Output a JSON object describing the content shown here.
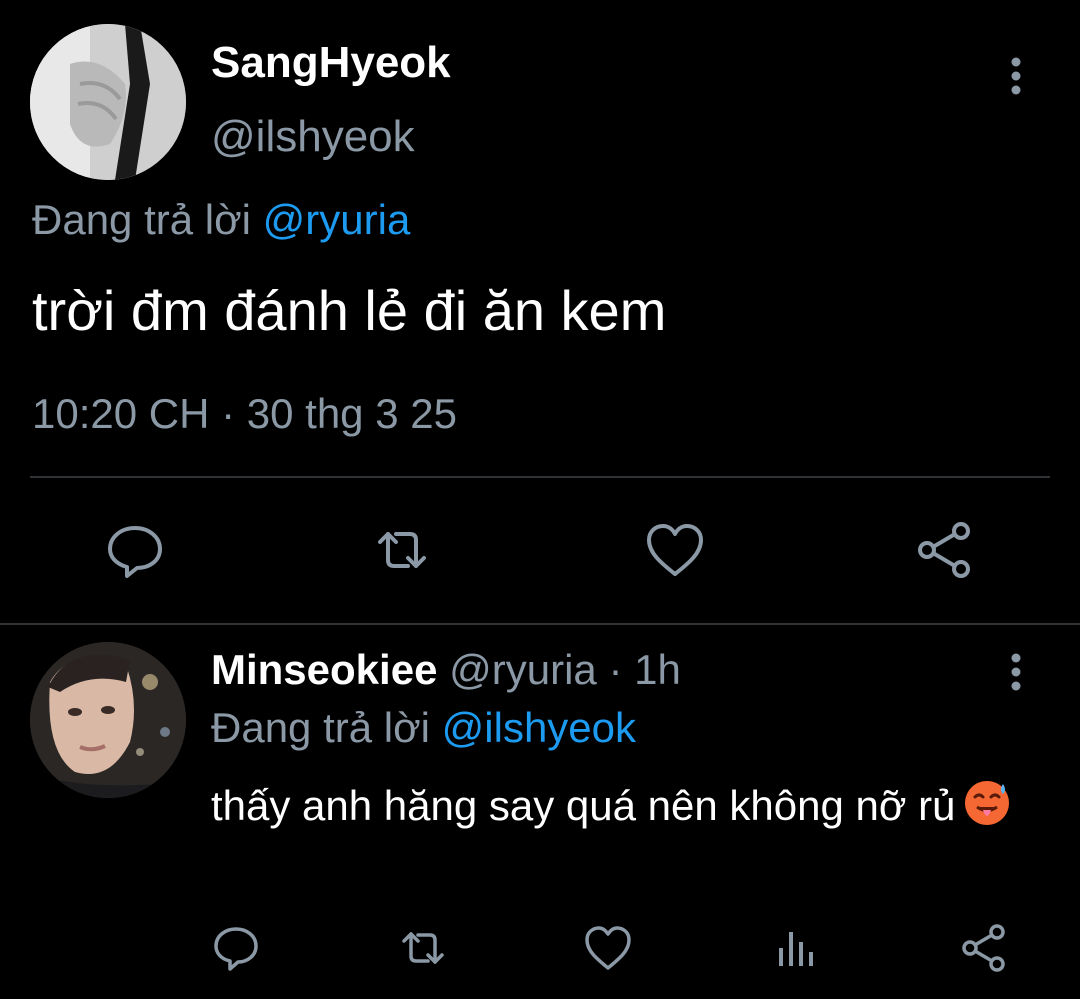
{
  "main_tweet": {
    "display_name": "SangHyeok",
    "handle": "@ilshyeok",
    "reply_prefix": "Đang trả lời",
    "reply_to": "@ryuria",
    "text": "trời đm đánh lẻ đi ăn kem",
    "timestamp": "10:20 CH · 30 thg 3 25",
    "actions": [
      "reply-icon",
      "retweet-icon",
      "like-icon",
      "share-icon"
    ],
    "more_icon": "more-vertical-icon"
  },
  "reply_tweet": {
    "display_name": "Minseokiee",
    "handle": "@ryuria",
    "time": "· 1h",
    "reply_prefix": "Đang trả lời",
    "reply_to": "@ilshyeok",
    "text": "thấy anh hăng say quá nên không nỡ rủ",
    "emoji": "hot-face-emoji",
    "actions": [
      "reply-icon",
      "retweet-icon",
      "like-icon",
      "analytics-icon",
      "share-icon"
    ],
    "more_icon": "more-vertical-icon"
  },
  "colors": {
    "background": "#000000",
    "text": "#ffffff",
    "muted": "#8b98a5",
    "link": "#1d9bf0",
    "divider": "#2f3336"
  }
}
